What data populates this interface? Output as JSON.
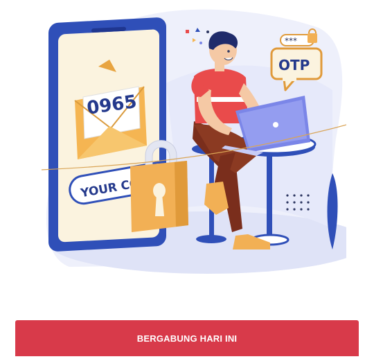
{
  "illustration": {
    "envelope_code": "0965",
    "code_label": "YOUR CODE",
    "otp_label": "OTP",
    "password_mask": "***"
  },
  "cta": {
    "label": "BERGABUNG HARI INI"
  },
  "colors": {
    "cta_background": "#d83a4a",
    "cta_text": "#ffffff",
    "phone_frame": "#2f4fb8",
    "envelope": "#f5b552",
    "lock": "#f2b055",
    "shirt": "#e94b4b",
    "laptop": "#7b86e8"
  }
}
